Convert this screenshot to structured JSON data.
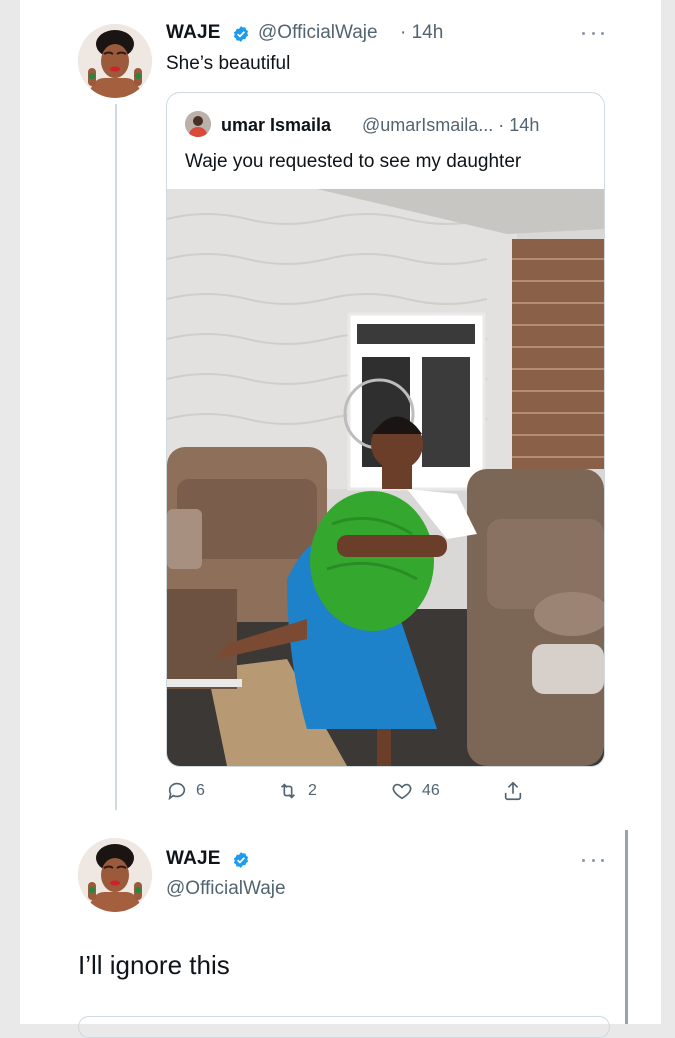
{
  "colors": {
    "accent": "#1d9bf0",
    "text": "#0f1419",
    "muted": "#536471",
    "border": "#cfd9de"
  },
  "tweet1": {
    "name": "WAJE",
    "handle": "@OfficialWaje",
    "time": "· 14h",
    "text": "She’s beautiful",
    "quote": {
      "name": "umar Ismaila",
      "handle": "@umarIsmaila... · 14h",
      "text": "Waje you requested to see my daughter"
    },
    "actions": {
      "replies": "6",
      "retweets": "2",
      "likes": "46"
    },
    "icons": [
      "reply-icon",
      "retweet-icon",
      "like-icon",
      "share-icon",
      "verified-icon",
      "more-icon"
    ]
  },
  "tweet2": {
    "name": "WAJE",
    "handle": "@OfficialWaje",
    "text": "I’ll ignore this"
  }
}
